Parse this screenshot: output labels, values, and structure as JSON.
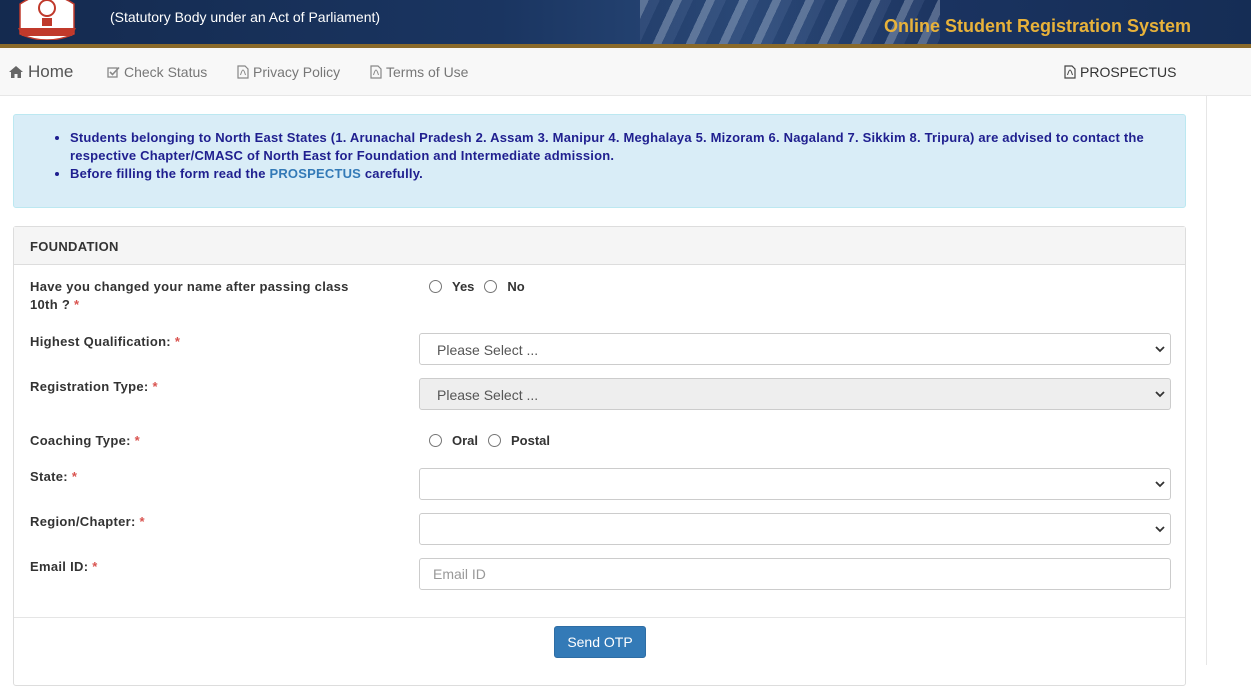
{
  "header": {
    "subtitle": "(Statutory Body under an Act of Parliament)",
    "system_title": "Online Student Registration System",
    "brand_color": "#e8b23a",
    "bg_color": "#142a4f"
  },
  "nav": {
    "home": "Home",
    "check_status": "Check Status",
    "privacy_policy": "Privacy Policy",
    "terms_of_use": "Terms of Use",
    "prospectus": "PROSPECTUS"
  },
  "alert": {
    "line1": "Students belonging to North East States (1. Arunachal Pradesh 2. Assam 3. Manipur 4. Meghalaya 5. Mizoram 6. Nagaland 7. Sikkim 8. Tripura) are advised to contact the respective Chapter/CMASC of North East for Foundation and Intermediate admission.",
    "line2_prefix": "Before filling the form read the",
    "line2_link": "PROSPECTUS",
    "line2_suffix": "carefully."
  },
  "panel": {
    "title": "FOUNDATION"
  },
  "form": {
    "name_change": {
      "label": "Have you changed your name after passing class 10th ?",
      "options": [
        "Yes",
        "No"
      ]
    },
    "qualification": {
      "label": "Highest Qualification:",
      "value": "Please Select ..."
    },
    "registration_type": {
      "label": "Registration Type:",
      "value": "Please Select ..."
    },
    "coaching_type": {
      "label": "Coaching Type:",
      "options": [
        "Oral",
        "Postal"
      ]
    },
    "state": {
      "label": "State:",
      "value": ""
    },
    "region": {
      "label": "Region/Chapter:",
      "value": ""
    },
    "email": {
      "label": "Email ID:",
      "placeholder": "Email ID"
    },
    "required_marker": "*",
    "submit_label": "Send OTP"
  }
}
